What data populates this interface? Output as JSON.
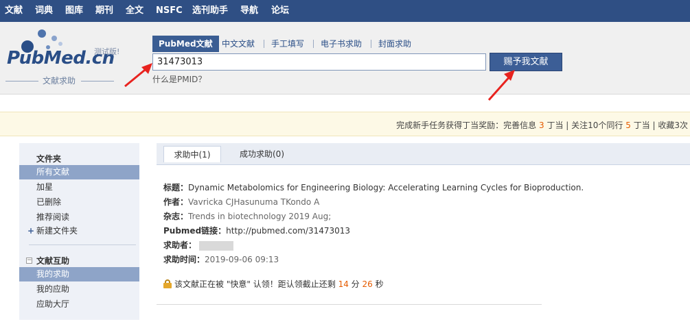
{
  "topnav": {
    "items": [
      "文献",
      "词典",
      "图库",
      "期刊",
      "全文",
      "NSFC",
      "选刊助手",
      "导航",
      "论坛"
    ]
  },
  "logo": {
    "text": "PubMed.cn",
    "beta": "测试版!",
    "subtitle": "文献求助"
  },
  "search": {
    "tabs": [
      "PubMed文献",
      "中文文献",
      "手工填写",
      "电子书求助",
      "封面求助"
    ],
    "active_tab": "PubMed文献",
    "value": "31473013",
    "button_label": "赐予我文献",
    "help_link": "什么是PMID？"
  },
  "notice": {
    "prefix": "完成新手任务获得丁当奖励：完善信息",
    "n1": "3",
    "mid1": "丁当 | 关注10个同行",
    "n2": "5",
    "mid2": "丁当 | 收藏3次"
  },
  "sidebar": {
    "section1_title": "文件夹",
    "folders": [
      "所有文献",
      "加星",
      "已删除",
      "推荐阅读"
    ],
    "new_folder": "新建文件夹",
    "section2_title": "文献互助",
    "mutual": [
      "我的求助",
      "我的应助",
      "应助大厅"
    ]
  },
  "main": {
    "tabs": [
      "求助中(1)",
      "成功求助(0)"
    ],
    "fields": {
      "title_label": "标题：",
      "title_value": "Dynamic Metabolomics for Engineering Biology: Accelerating Learning Cycles for Bioproduction.",
      "author_label": "作者：",
      "author_value": "Vavricka CJHasunuma TKondo A",
      "journal_label": "杂志：",
      "journal_value": "Trends in biotechnology 2019 Aug;",
      "pubmed_label": "Pubmed链接：",
      "pubmed_value": "http://pubmed.com/31473013",
      "requester_label": "求助者：",
      "time_label": "求助时间：",
      "time_value": "2019-09-06 09:13"
    },
    "claim": {
      "prefix": "该文献正在被",
      "claimer": "\"快意\"",
      "middle": "认领！距认领截止还剩",
      "minutes": "14",
      "min_unit": "分",
      "seconds": "26",
      "sec_unit": "秒"
    }
  },
  "colors": {
    "nav_bg": "#2f4f84",
    "accent": "#3c5e96",
    "highlight": "#e55b00",
    "annotation_arrow": "#e8231f"
  }
}
